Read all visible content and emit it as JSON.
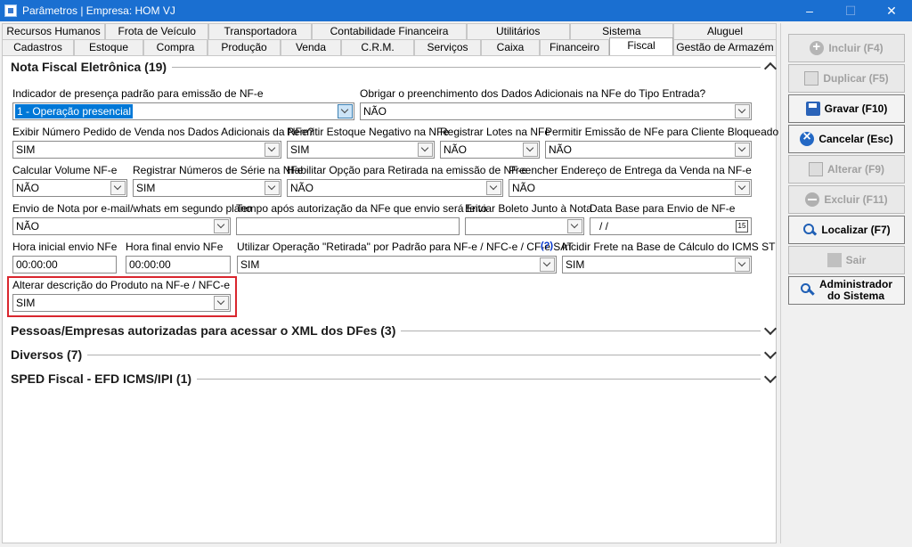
{
  "window": {
    "title": "Parâmetros | Empresa: HOM VJ",
    "min": "–",
    "max": "☐",
    "close": "✕"
  },
  "tabs_row1": [
    "Recursos Humanos",
    "Frota de Veículo",
    "Transportadora",
    "Contabilidade Financeira",
    "Utilitários",
    "Sistema",
    "Aluguel"
  ],
  "tabs_row2": [
    "Cadastros",
    "Estoque",
    "Compra",
    "Produção",
    "Venda",
    "C.R.M.",
    "Serviços",
    "Caixa",
    "Financeiro",
    "Fiscal",
    "Gestão de Armazém"
  ],
  "active_tab": "Fiscal",
  "sections": {
    "nfe": {
      "title": "Nota Fiscal Eletrônica (19)"
    },
    "pessoas": {
      "title": "Pessoas/Empresas autorizadas para acessar o XML dos DFes (3)"
    },
    "diversos": {
      "title": "Diversos (7)"
    },
    "sped": {
      "title": "SPED Fiscal - EFD ICMS/IPI (1)"
    }
  },
  "fields": {
    "presenca": {
      "label": "Indicador de presença padrão para emissão de NF-e",
      "value": "1 - Operação presencial"
    },
    "dados_adic": {
      "label": "Obrigar o preenchimento dos Dados Adicionais na NFe do Tipo Entrada?",
      "value": "NÃO"
    },
    "num_pedido": {
      "label": "Exibir Número Pedido de Venda nos Dados Adicionais da NFe?",
      "value": "SIM"
    },
    "estoque_neg": {
      "label": "Permitir Estoque Negativo na NFe",
      "value": "SIM"
    },
    "lotes": {
      "label": "Registrar Lotes na NFe",
      "value": "NÃO"
    },
    "cliente_bloq": {
      "label": "Permitir Emissão de NFe para Cliente Bloqueado",
      "value": "NÃO"
    },
    "volume": {
      "label": "Calcular Volume NF-e",
      "value": "NÃO"
    },
    "serie": {
      "label": "Registrar Números de Série na NFe",
      "value": "SIM"
    },
    "retirada": {
      "label": "Habilitar Opção para Retirada na emissão de NF-e",
      "value": "NÃO"
    },
    "endereco": {
      "label": "Preencher Endereço de Entrega da Venda na NF-e",
      "value": "NÃO"
    },
    "envio_nota": {
      "label": "Envio de Nota por e-mail/whats em segundo plano",
      "value": "NÃO"
    },
    "tempo_envio": {
      "label": "Tempo após autorização da NFe que envio será feito",
      "value": ""
    },
    "boleto": {
      "label": "Enviar Boleto Junto à Nota",
      "value": ""
    },
    "data_base": {
      "label": "Data Base para Envio de NF-e",
      "value": " /  /"
    },
    "hora_ini": {
      "label": "Hora inicial envio NFe",
      "value": "00:00:00"
    },
    "hora_fim": {
      "label": "Hora final envio NFe",
      "value": "00:00:00"
    },
    "op_retirada": {
      "label": "Utilizar Operação \"Retirada\" por Padrão para NF-e / NFC-e / CF-e SAT",
      "help": "(?)",
      "value": "SIM"
    },
    "frete": {
      "label": "Incidir Frete na Base de Cálculo do ICMS ST",
      "value": "SIM"
    },
    "desc_produto": {
      "label": "Alterar descrição do Produto na NF-e / NFC-e",
      "value": "SIM"
    }
  },
  "buttons": {
    "incluir": "Incluir (F4)",
    "duplicar": "Duplicar (F5)",
    "gravar": "Gravar (F10)",
    "cancelar": "Cancelar (Esc)",
    "alterar": "Alterar (F9)",
    "excluir": "Excluir (F11)",
    "localizar": "Localizar (F7)",
    "sair": "Sair",
    "admin_1": "Administrador",
    "admin_2": "do Sistema"
  }
}
